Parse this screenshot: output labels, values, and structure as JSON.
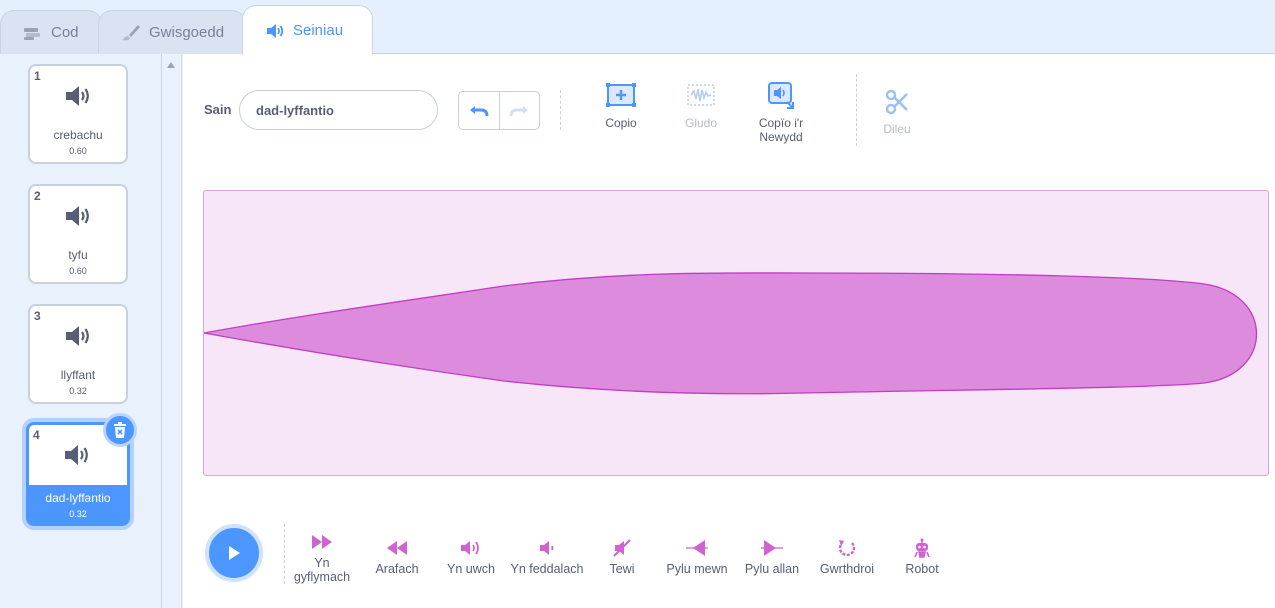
{
  "tabs": [
    {
      "label": "Cod",
      "icon": "code-icon"
    },
    {
      "label": "Gwisgoedd",
      "icon": "brush-icon"
    },
    {
      "label": "Seiniau",
      "icon": "speaker-icon",
      "active": true
    }
  ],
  "sounds": [
    {
      "num": "1",
      "name": "crebachu",
      "duration": "0.60"
    },
    {
      "num": "2",
      "name": "tyfu",
      "duration": "0.60"
    },
    {
      "num": "3",
      "name": "llyffant",
      "duration": "0.32"
    },
    {
      "num": "4",
      "name": "dad-lyffantio",
      "duration": "0.32",
      "selected": true
    }
  ],
  "editor": {
    "sound_label": "Sain",
    "sound_name": "dad-lyffantio",
    "tools": {
      "copy": "Copio",
      "paste": "Gludo",
      "copy_new_1": "Copïo i'r",
      "copy_new_2": "Newydd",
      "delete": "Dileu"
    }
  },
  "effects": [
    {
      "label_1": "Yn",
      "label_2": "gyflymach",
      "icon": "faster-icon"
    },
    {
      "label_1": "Arafach",
      "icon": "slower-icon"
    },
    {
      "label_1": "Yn uwch",
      "icon": "louder-icon"
    },
    {
      "label_1": "Yn feddalach",
      "icon": "softer-icon"
    },
    {
      "label_1": "Tewi",
      "icon": "mute-icon"
    },
    {
      "label_1": "Pylu mewn",
      "icon": "fade-in-icon"
    },
    {
      "label_1": "Pylu allan",
      "icon": "fade-out-icon"
    },
    {
      "label_1": "Gwrthdroi",
      "icon": "reverse-icon"
    },
    {
      "label_1": "Robot",
      "icon": "robot-icon"
    }
  ],
  "colors": {
    "accent": "#4c97ff",
    "sound": "#cf63cf",
    "waveform_fill": "#dd8cdd",
    "waveform_bg": "#f7e5f8"
  }
}
